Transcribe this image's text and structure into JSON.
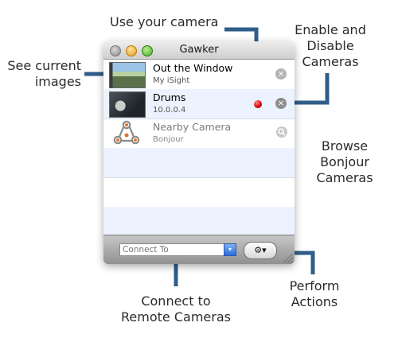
{
  "callouts": {
    "use_camera": "Use your camera",
    "enable_disable": [
      "Enable and",
      "Disable",
      "Cameras"
    ],
    "see_current": [
      "See current",
      "images"
    ],
    "browse": [
      "Browse",
      "Bonjour",
      "Cameras"
    ],
    "connect": [
      "Connect to",
      "Remote Cameras"
    ],
    "perform": [
      "Perform",
      "Actions"
    ]
  },
  "window": {
    "title": "Gawker"
  },
  "cameras": [
    {
      "name": "Out the Window",
      "detail": "My iSight",
      "enabled": false
    },
    {
      "name": "Drums",
      "detail": "10.0.0.4",
      "enabled": true
    },
    {
      "name": "Nearby Camera",
      "detail": "Bonjour",
      "enabled": false
    }
  ],
  "toolbar": {
    "connect_placeholder": "Connect To",
    "action_label": "⚙▾"
  },
  "icons": {
    "connector_color": "#2f5e89",
    "close_glyph": "×"
  }
}
